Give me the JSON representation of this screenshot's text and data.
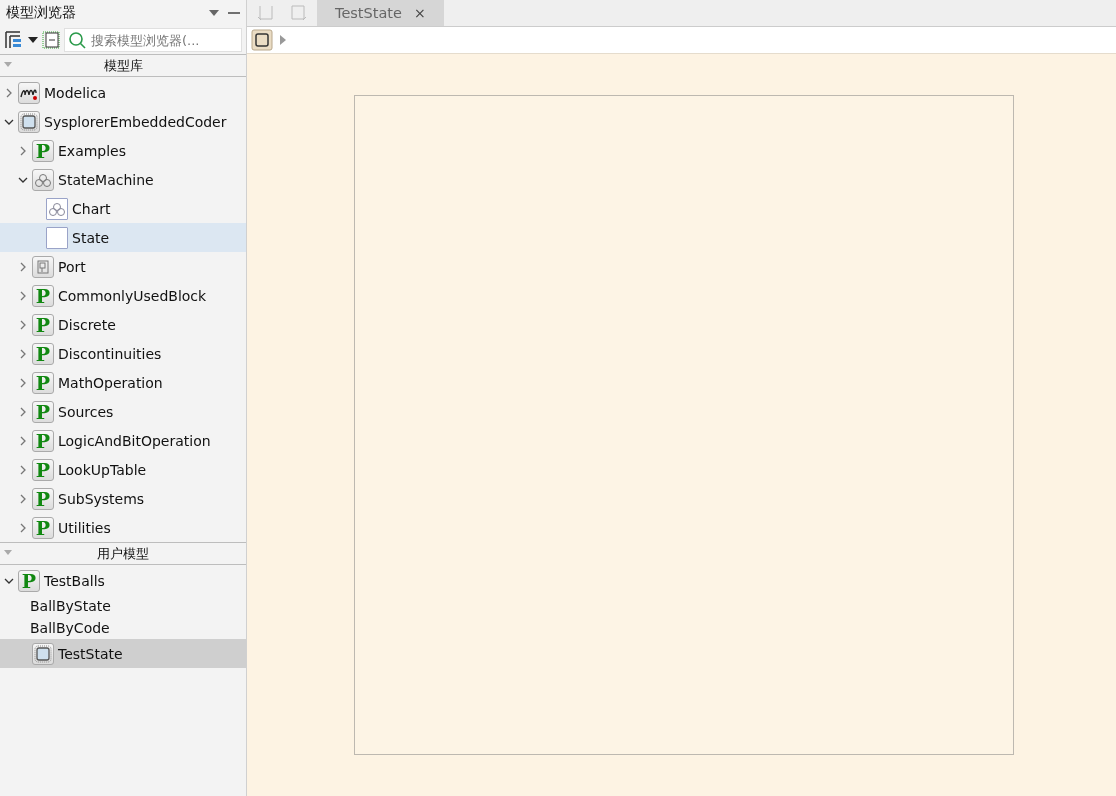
{
  "panel": {
    "title": "模型浏览器",
    "search": {
      "placeholder": "搜索模型浏览器(..."
    }
  },
  "library": {
    "title": "模型库",
    "items": [
      {
        "label": "Modelica",
        "kind": "modelica",
        "expanded": false,
        "selected": false,
        "hovered": false
      },
      {
        "label": "SysplorerEmbeddedCoder",
        "kind": "chip",
        "expanded": true,
        "selected": false,
        "hovered": false,
        "children": [
          {
            "label": "Examples",
            "kind": "package",
            "badge": "P",
            "expanded": false,
            "selected": false,
            "hovered": false
          },
          {
            "label": "StateMachine",
            "kind": "statemachine",
            "expanded": true,
            "selected": false,
            "hovered": false,
            "children": [
              {
                "label": "Chart",
                "kind": "chart",
                "selected": false,
                "hovered": false
              },
              {
                "label": "State",
                "kind": "state",
                "selected": false,
                "hovered": true
              }
            ]
          },
          {
            "label": "Port",
            "kind": "port",
            "expanded": false,
            "selected": false,
            "hovered": false
          },
          {
            "label": "CommonlyUsedBlock",
            "kind": "package",
            "badge": "P",
            "expanded": false,
            "selected": false,
            "hovered": false
          },
          {
            "label": "Discrete",
            "kind": "package",
            "badge": "P",
            "expanded": false,
            "selected": false,
            "hovered": false
          },
          {
            "label": "Discontinuities",
            "kind": "package",
            "badge": "P",
            "expanded": false,
            "selected": false,
            "hovered": false
          },
          {
            "label": "MathOperation",
            "kind": "package",
            "badge": "P",
            "expanded": false,
            "selected": false,
            "hovered": false
          },
          {
            "label": "Sources",
            "kind": "package",
            "badge": "P",
            "expanded": false,
            "selected": false,
            "hovered": false
          },
          {
            "label": "LogicAndBitOperation",
            "kind": "package",
            "badge": "P",
            "expanded": false,
            "selected": false,
            "hovered": false
          },
          {
            "label": "LookUpTable",
            "kind": "package",
            "badge": "P",
            "expanded": false,
            "selected": false,
            "hovered": false
          },
          {
            "label": "SubSystems",
            "kind": "package",
            "badge": "P",
            "expanded": false,
            "selected": false,
            "hovered": false
          },
          {
            "label": "Utilities",
            "kind": "package",
            "badge": "P",
            "expanded": false,
            "selected": false,
            "hovered": false
          }
        ]
      }
    ]
  },
  "user_models": {
    "title": "用户模型",
    "items": [
      {
        "label": "TestBalls",
        "kind": "package",
        "badge": "P",
        "expanded": true,
        "selected": false,
        "hovered": false,
        "children": [
          {
            "label": "BallByState",
            "kind": "none",
            "selected": false,
            "hovered": false
          },
          {
            "label": "BallByCode",
            "kind": "none",
            "selected": false,
            "hovered": false
          },
          {
            "label": "TestState",
            "kind": "chip",
            "selected": true,
            "hovered": false
          }
        ]
      }
    ]
  },
  "editor": {
    "tabs": [
      {
        "label": "TestState",
        "selected": true,
        "close": "×"
      }
    ]
  }
}
